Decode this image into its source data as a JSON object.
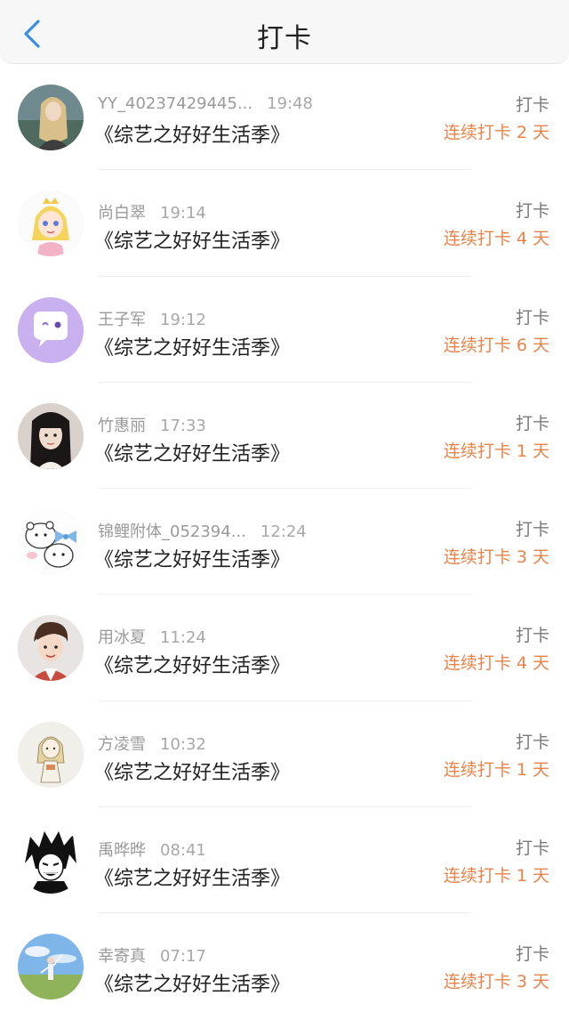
{
  "header": {
    "title": "打卡",
    "back_icon": "chevron-left-icon",
    "accent": "#3a8ee6"
  },
  "colors": {
    "streak": "#e8844a",
    "primary_text": "#222222",
    "secondary_text": "#9a9a9a"
  },
  "items": [
    {
      "user": "YY_40237429445...",
      "time": "19:48",
      "book": "《综艺之好好生活季》",
      "action": "打卡",
      "streak": "连续打卡 2 天",
      "avatar": "avatar-photo-girl-lake"
    },
    {
      "user": "尚白翠",
      "time": "19:14",
      "book": "《综艺之好好生活季》",
      "action": "打卡",
      "streak": "连续打卡 4 天",
      "avatar": "avatar-cartoon-princess"
    },
    {
      "user": "王子军",
      "time": "19:12",
      "book": "《综艺之好好生活季》",
      "action": "打卡",
      "streak": "连续打卡 6 天",
      "avatar": "avatar-chat-bubble-purple"
    },
    {
      "user": "竹惠丽",
      "time": "17:33",
      "book": "《综艺之好好生活季》",
      "action": "打卡",
      "streak": "连续打卡 1 天",
      "avatar": "avatar-photo-girl-dark-hair"
    },
    {
      "user": "锦鲤附体_052394...",
      "time": "12:24",
      "book": "《综艺之好好生活季》",
      "action": "打卡",
      "streak": "连续打卡 3 天",
      "avatar": "avatar-cartoon-bears"
    },
    {
      "user": "用冰夏",
      "time": "11:24",
      "book": "《综艺之好好生活季》",
      "action": "打卡",
      "streak": "连续打卡 4 天",
      "avatar": "avatar-photo-boy"
    },
    {
      "user": "方凌雪",
      "time": "10:32",
      "book": "《综艺之好好生活季》",
      "action": "打卡",
      "streak": "连续打卡 1 天",
      "avatar": "avatar-sketch-girl"
    },
    {
      "user": "禹晔晔",
      "time": "08:41",
      "book": "《综艺之好好生活季》",
      "action": "打卡",
      "streak": "连续打卡 1 天",
      "avatar": "avatar-anime-bw"
    },
    {
      "user": "幸寄真",
      "time": "07:17",
      "book": "《综艺之好好生活季》",
      "action": "打卡",
      "streak": "连续打卡 3 天",
      "avatar": "avatar-photo-field-sky"
    }
  ]
}
